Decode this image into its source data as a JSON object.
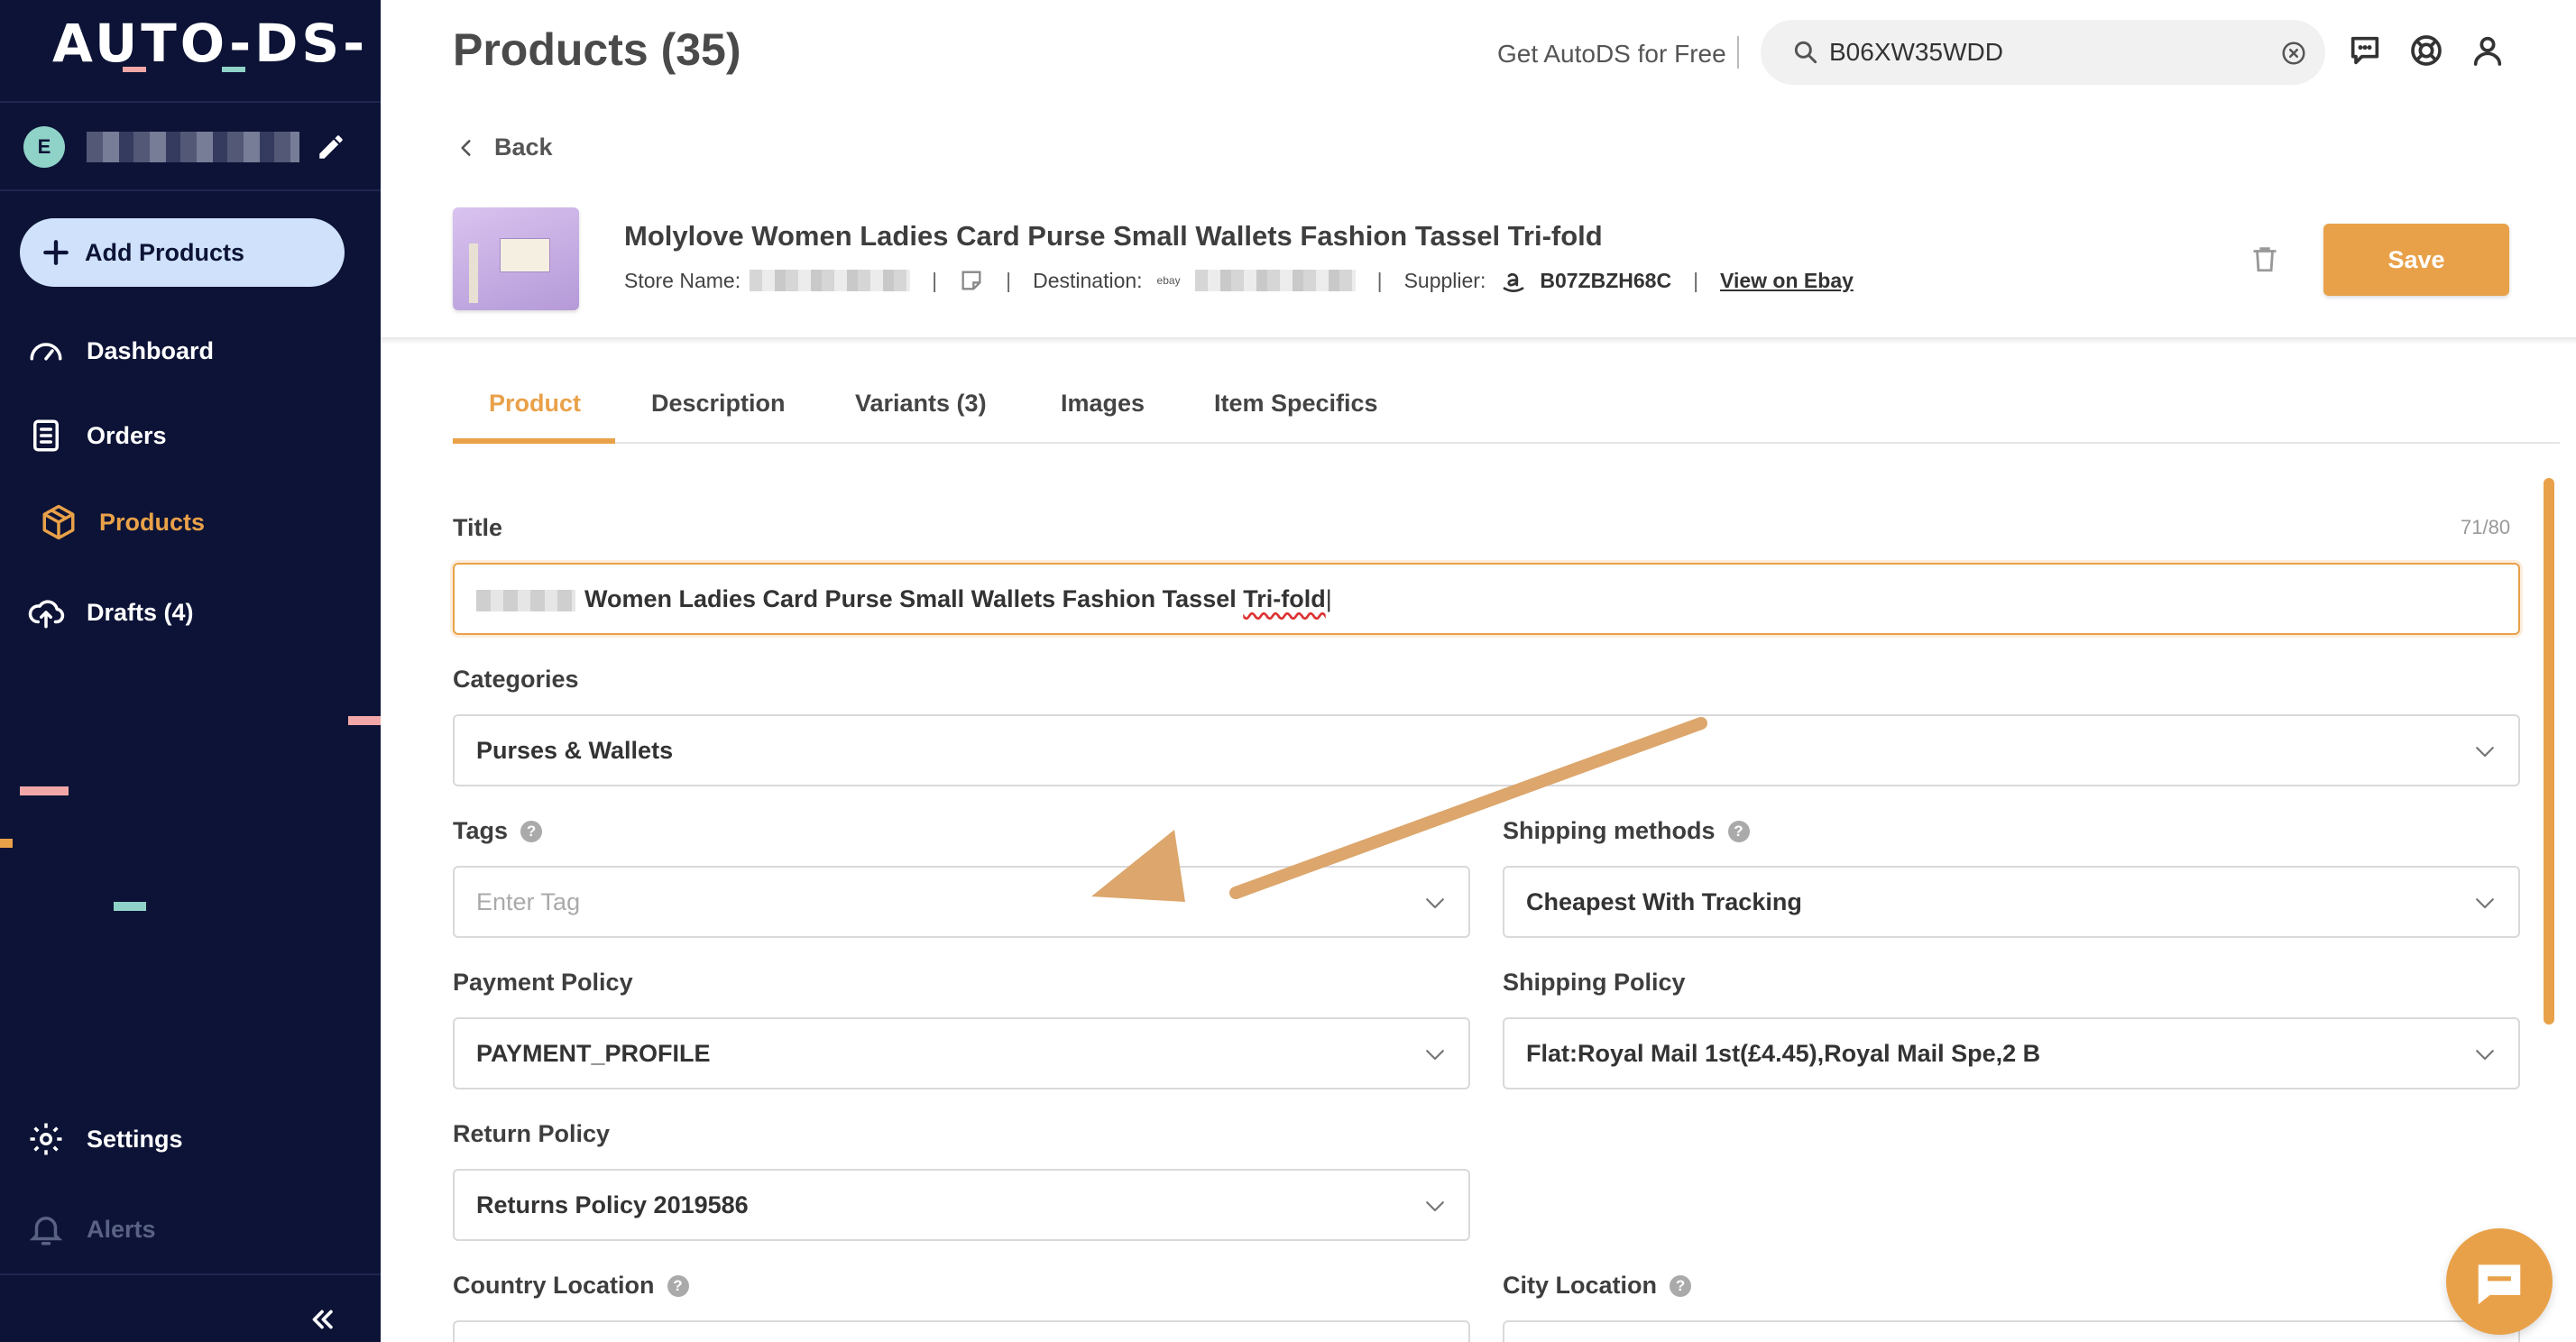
{
  "sidebar": {
    "logo": "AUTO-DS-",
    "user_initial": "E",
    "add_products": "Add Products",
    "nav": {
      "dashboard": "Dashboard",
      "orders": "Orders",
      "products": "Products",
      "drafts": "Drafts (4)",
      "settings": "Settings",
      "alerts": "Alerts"
    }
  },
  "header": {
    "page_title": "Products (35)",
    "get_free": "Get AutoDS for Free",
    "search_value": "B06XW35WDD"
  },
  "product": {
    "back": "Back",
    "title": "Molylove Women Ladies Card Purse Small Wallets Fashion Tassel Tri-fold",
    "store_label": "Store Name:",
    "destination_label": "Destination:",
    "destination_brand": "ebay",
    "supplier_label": "Supplier:",
    "supplier_id": "B07ZBZH68C",
    "view_link": "View on Ebay",
    "save": "Save"
  },
  "tabs": [
    "Product",
    "Description",
    "Variants (3)",
    "Images",
    "Item Specifics"
  ],
  "form": {
    "title_label": "Title",
    "title_counter": "71/80",
    "title_value": "Women Ladies Card Purse Small Wallets Fashion Tassel",
    "title_value_end": "Tri-fold",
    "categories_label": "Categories",
    "categories_value": "Purses & Wallets",
    "tags_label": "Tags",
    "tags_placeholder": "Enter Tag",
    "shipping_methods_label": "Shipping methods",
    "shipping_methods_value": "Cheapest With Tracking",
    "payment_policy_label": "Payment Policy",
    "payment_policy_value": "PAYMENT_PROFILE",
    "shipping_policy_label": "Shipping Policy",
    "shipping_policy_value": "Flat:Royal Mail 1st(£4.45),Royal Mail Spe,2 B",
    "return_policy_label": "Return Policy",
    "return_policy_value": "Returns Policy 2019586",
    "country_location_label": "Country Location",
    "city_location_label": "City Location",
    "help_glyph": "?"
  },
  "colors": {
    "sidebar_bg": "#0c1336",
    "accent": "#e9a149",
    "add_button_bg": "#cfe1fb"
  }
}
